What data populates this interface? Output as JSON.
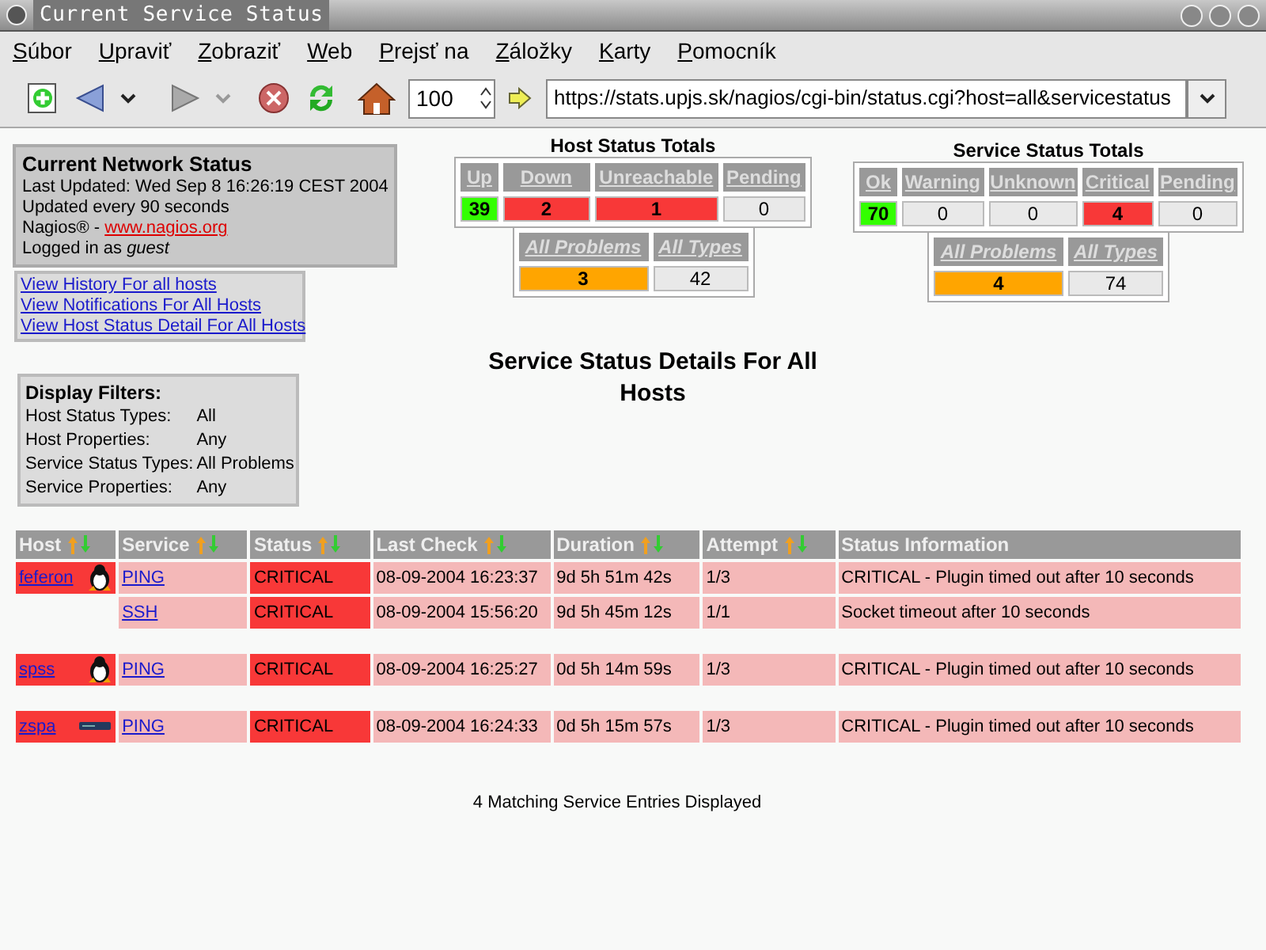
{
  "window": {
    "title": "Current Service Status"
  },
  "menu": [
    "Súbor",
    "Upraviť",
    "Zobraziť",
    "Web",
    "Prejsť na",
    "Záložky",
    "Karty",
    "Pomocník"
  ],
  "toolbar": {
    "zoom": "100",
    "url": "https://stats.upjs.sk/nagios/cgi-bin/status.cgi?host=all&servicestatus"
  },
  "network_status": {
    "title": "Current Network Status",
    "last_updated": "Last Updated: Wed Sep 8 16:26:19 CEST 2004",
    "interval": "Updated every 90 seconds",
    "nagios_prefix": "Nagios® - ",
    "nagios_link": "www.nagios.org",
    "logged_in": "Logged in as *guest*"
  },
  "links": [
    "View History For all hosts",
    "View Notifications For All Hosts",
    "View Host Status Detail For All Hosts"
  ],
  "display_filters": {
    "title": "Display Filters:",
    "rows": [
      {
        "label": "Host Status Types:",
        "value": "All"
      },
      {
        "label": "Host Properties:",
        "value": "Any"
      },
      {
        "label": "Service Status Types:",
        "value": "All Problems"
      },
      {
        "label": "Service Properties:",
        "value": "Any"
      }
    ]
  },
  "host_totals": {
    "title": "Host Status Totals",
    "cells": [
      {
        "label": "Up",
        "count": "39",
        "color": "#33ff00"
      },
      {
        "label": "Down",
        "count": "2",
        "color": "#f83838"
      },
      {
        "label": "Unreachable",
        "count": "1",
        "color": "#f83838"
      },
      {
        "label": "Pending",
        "count": "0",
        "color": "#e9e9e9"
      }
    ],
    "summary": [
      {
        "label": "All Problems",
        "count": "3",
        "color": "#ffa500"
      },
      {
        "label": "All Types",
        "count": "42",
        "color": "#e9e9e9"
      }
    ]
  },
  "service_totals": {
    "title": "Service Status Totals",
    "cells": [
      {
        "label": "Ok",
        "count": "70",
        "color": "#33ff00"
      },
      {
        "label": "Warning",
        "count": "0",
        "color": "#e9e9e9"
      },
      {
        "label": "Unknown",
        "count": "0",
        "color": "#e9e9e9"
      },
      {
        "label": "Critical",
        "count": "4",
        "color": "#f83838"
      },
      {
        "label": "Pending",
        "count": "0",
        "color": "#e9e9e9"
      }
    ],
    "summary": [
      {
        "label": "All Problems",
        "count": "4",
        "color": "#ffa500"
      },
      {
        "label": "All Types",
        "count": "74",
        "color": "#e9e9e9"
      }
    ]
  },
  "heading": "Service Status Details For All Hosts",
  "table": {
    "columns": [
      {
        "label": "Host",
        "sortable": true
      },
      {
        "label": "Service",
        "sortable": true
      },
      {
        "label": "Status",
        "sortable": true
      },
      {
        "label": "Last Check",
        "sortable": true
      },
      {
        "label": "Duration",
        "sortable": true
      },
      {
        "label": "Attempt",
        "sortable": true
      },
      {
        "label": "Status Information",
        "sortable": false
      }
    ],
    "hosts": [
      {
        "name": "feferon",
        "kind": "penguin",
        "color": "#f83838",
        "services": [
          {
            "service": "PING",
            "status": "CRITICAL",
            "color": "#f83838",
            "last_check": "08-09-2004 16:23:37",
            "duration": "9d 5h 51m 42s",
            "attempt": "1/3",
            "info": "CRITICAL - Plugin timed out after 10 seconds"
          },
          {
            "service": "SSH",
            "status": "CRITICAL",
            "color": "#f83838",
            "last_check": "08-09-2004 15:56:20",
            "duration": "9d 5h 45m 12s",
            "attempt": "1/1",
            "info": "Socket timeout after 10 seconds"
          }
        ]
      },
      {
        "name": "spss",
        "kind": "penguin",
        "color": "#f83838",
        "services": [
          {
            "service": "PING",
            "status": "CRITICAL",
            "color": "#f83838",
            "last_check": "08-09-2004 16:25:27",
            "duration": "0d 5h 14m 59s",
            "attempt": "1/3",
            "info": "CRITICAL - Plugin timed out after 10 seconds"
          }
        ]
      },
      {
        "name": "zspa",
        "kind": "device",
        "color": "#f83838",
        "services": [
          {
            "service": "PING",
            "status": "CRITICAL",
            "color": "#f83838",
            "last_check": "08-09-2004 16:24:33",
            "duration": "0d 5h 15m 57s",
            "attempt": "1/3",
            "info": "CRITICAL - Plugin timed out after 10 seconds"
          }
        ]
      }
    ]
  },
  "footer": "4 Matching Service Entries Displayed"
}
